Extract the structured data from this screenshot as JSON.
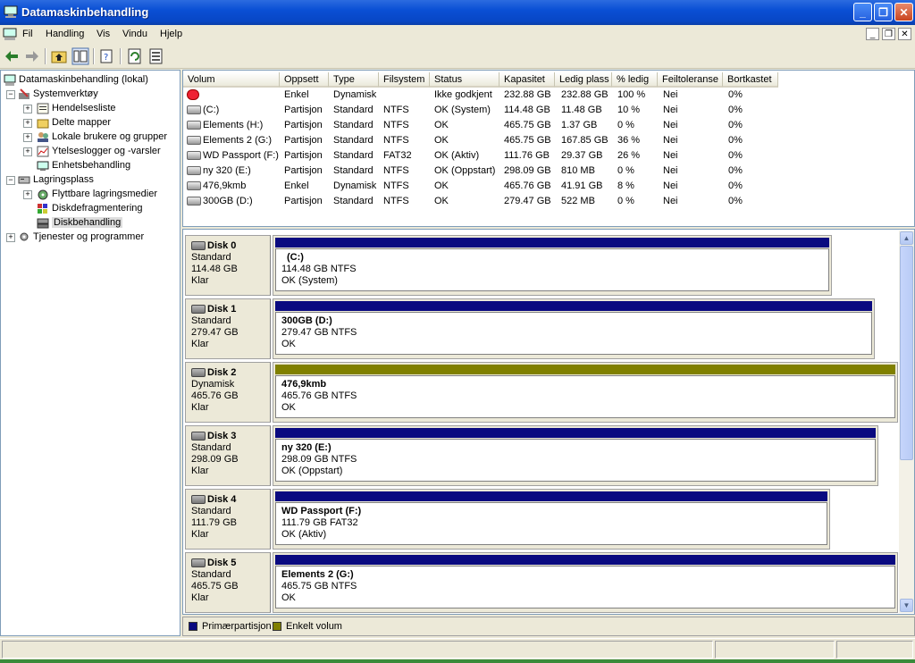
{
  "window": {
    "title": "Datamaskinbehandling"
  },
  "menu": [
    "Fil",
    "Handling",
    "Vis",
    "Vindu",
    "Hjelp"
  ],
  "tree": {
    "root": "Datamaskinbehandling (lokal)",
    "system_tools": "Systemverktøy",
    "system_items": [
      "Hendelsesliste",
      "Delte mapper",
      "Lokale brukere og grupper",
      "Ytelseslogger og -varsler",
      "Enhetsbehandling"
    ],
    "storage": "Lagringsplass",
    "storage_items": [
      "Flyttbare lagringsmedier",
      "Diskdefragmentering",
      "Diskbehandling"
    ],
    "services": "Tjenester og programmer"
  },
  "list": {
    "headers": [
      "Volum",
      "Oppsett",
      "Type",
      "Filsystem",
      "Status",
      "Kapasitet",
      "Ledig plass",
      "% ledig",
      "Feiltoleranse",
      "Bortkastet"
    ],
    "rows": [
      [
        "",
        "Enkel",
        "Dynamisk",
        "",
        "Ikke godkjent",
        "232.88 GB",
        "232.88 GB",
        "100 %",
        "Nei",
        "0%"
      ],
      [
        "(C:)",
        "Partisjon",
        "Standard",
        "NTFS",
        "OK (System)",
        "114.48 GB",
        "11.48 GB",
        "10 %",
        "Nei",
        "0%"
      ],
      [
        "Elements (H:)",
        "Partisjon",
        "Standard",
        "NTFS",
        "OK",
        "465.75 GB",
        "1.37 GB",
        "0 %",
        "Nei",
        "0%"
      ],
      [
        "Elements 2 (G:)",
        "Partisjon",
        "Standard",
        "NTFS",
        "OK",
        "465.75 GB",
        "167.85 GB",
        "36 %",
        "Nei",
        "0%"
      ],
      [
        "WD Passport (F:)",
        "Partisjon",
        "Standard",
        "FAT32",
        "OK (Aktiv)",
        "111.76 GB",
        "29.37 GB",
        "26 %",
        "Nei",
        "0%"
      ],
      [
        "ny 320 (E:)",
        "Partisjon",
        "Standard",
        "NTFS",
        "OK (Oppstart)",
        "298.09 GB",
        "810 MB",
        "0 %",
        "Nei",
        "0%"
      ],
      [
        "476,9kmb",
        "Enkel",
        "Dynamisk",
        "NTFS",
        "OK",
        "465.76 GB",
        "41.91 GB",
        "8 %",
        "Nei",
        "0%"
      ],
      [
        "300GB (D:)",
        "Partisjon",
        "Standard",
        "NTFS",
        "OK",
        "279.47 GB",
        "522 MB",
        "0 %",
        "Nei",
        "0%"
      ]
    ]
  },
  "disks": [
    {
      "name": "Disk 0",
      "kind": "Standard",
      "size": "114.48 GB",
      "state": "Klar",
      "vol": "(C:)",
      "info": "114.48 GB NTFS",
      "status": "OK (System)",
      "color": "#0a0a80"
    },
    {
      "name": "Disk 1",
      "kind": "Standard",
      "size": "279.47 GB",
      "state": "Klar",
      "vol": "300GB  (D:)",
      "info": "279.47 GB NTFS",
      "status": "OK",
      "color": "#0a0a80"
    },
    {
      "name": "Disk 2",
      "kind": "Dynamisk",
      "size": "465.76 GB",
      "state": "Klar",
      "vol": "476,9kmb",
      "info": "465.76 GB NTFS",
      "status": "OK",
      "color": "#808000"
    },
    {
      "name": "Disk 3",
      "kind": "Standard",
      "size": "298.09 GB",
      "state": "Klar",
      "vol": "ny 320  (E:)",
      "info": "298.09 GB NTFS",
      "status": "OK (Oppstart)",
      "color": "#0a0a80"
    },
    {
      "name": "Disk 4",
      "kind": "Standard",
      "size": "111.79 GB",
      "state": "Klar",
      "vol": "WD Passport  (F:)",
      "info": "111.79 GB FAT32",
      "status": "OK (Aktiv)",
      "color": "#0a0a80"
    },
    {
      "name": "Disk 5",
      "kind": "Standard",
      "size": "465.75 GB",
      "state": "Klar",
      "vol": "Elements 2  (G:)",
      "info": "465.75 GB NTFS",
      "status": "OK",
      "color": "#0a0a80"
    }
  ],
  "legend": {
    "primary": "Primærpartisjon",
    "simple": "Enkelt volum",
    "primary_color": "#0a0a80",
    "simple_color": "#808000"
  }
}
